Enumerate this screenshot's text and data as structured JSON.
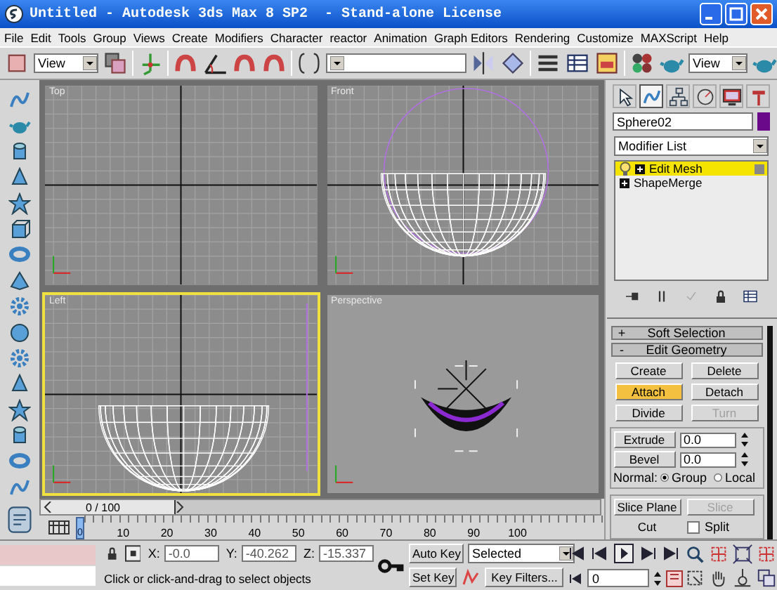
{
  "window": {
    "title": "Untitled - Autodesk 3ds Max 8 SP2  - Stand-alone License"
  },
  "menu": [
    "File",
    "Edit",
    "Tools",
    "Group",
    "Views",
    "Create",
    "Modifiers",
    "Character",
    "reactor",
    "Animation",
    "Graph Editors",
    "Rendering",
    "Customize",
    "MAXScript",
    "Help"
  ],
  "toolbar": {
    "reference_coordinate": "View",
    "render_type": "View"
  },
  "viewports": [
    {
      "label": "Top",
      "selected": false,
      "kind": "grid"
    },
    {
      "label": "Front",
      "selected": false,
      "kind": "hemisphere-front"
    },
    {
      "label": "Left",
      "selected": true,
      "kind": "hemisphere-side"
    },
    {
      "label": "Perspective",
      "selected": false,
      "kind": "bowl"
    }
  ],
  "command_panel": {
    "tabs": [
      {
        "selected": false
      },
      {
        "selected": true
      },
      {
        "selected": false
      },
      {
        "selected": false
      },
      {
        "selected": false
      },
      {
        "selected": false
      }
    ],
    "object_name": "Sphere02",
    "modifier_list": "Modifier List",
    "stack": [
      {
        "label": "Edit Mesh",
        "selected": true
      },
      {
        "label": "ShapeMerge",
        "selected": false
      }
    ],
    "rollouts": [
      {
        "sign": "+",
        "label": "Soft Selection"
      },
      {
        "sign": "-",
        "label": "Edit Geometry"
      }
    ],
    "buttons": [
      {
        "label": "Create",
        "active": false,
        "disabled": false
      },
      {
        "label": "Delete",
        "active": false,
        "disabled": false
      },
      {
        "label": "Attach",
        "active": true,
        "disabled": false
      },
      {
        "label": "Detach",
        "active": false,
        "disabled": false
      },
      {
        "label": "Divide",
        "active": false,
        "disabled": false
      },
      {
        "label": "Turn",
        "active": false,
        "disabled": true
      }
    ],
    "spinners": [
      {
        "label": "Extrude",
        "value": "0.0"
      },
      {
        "label": "Bevel",
        "value": "0.0"
      }
    ],
    "normal": {
      "label": "Normal:",
      "options": [
        {
          "label": "Group",
          "selected": true
        },
        {
          "label": "Local",
          "selected": false
        }
      ]
    },
    "slice_buttons": [
      {
        "label": "Slice Plane",
        "disabled": false
      },
      {
        "label": "Slice",
        "disabled": true
      }
    ],
    "cut": {
      "label": "Cut",
      "disabled": false
    },
    "split": {
      "label": "Split",
      "checked": false
    }
  },
  "time_slider": {
    "label": "0 / 100",
    "level": 0
  },
  "track_bar": {
    "current": "0",
    "labels": [
      "10",
      "20",
      "30",
      "40",
      "50",
      "60",
      "70",
      "80",
      "90",
      "100"
    ]
  },
  "status": {
    "coordinates": [
      {
        "axis": "X:",
        "value": "-0.0"
      },
      {
        "axis": "Y:",
        "value": "-40.262"
      },
      {
        "axis": "Z:",
        "value": "-15.337"
      }
    ],
    "prompt": "Click or click-and-drag to select objects"
  },
  "animation": {
    "auto_key": {
      "label": "Auto Key",
      "on": false
    },
    "key_set": "Selected",
    "set_key": "Set Key",
    "key_filters": "Key Filters...",
    "frame": "0"
  }
}
